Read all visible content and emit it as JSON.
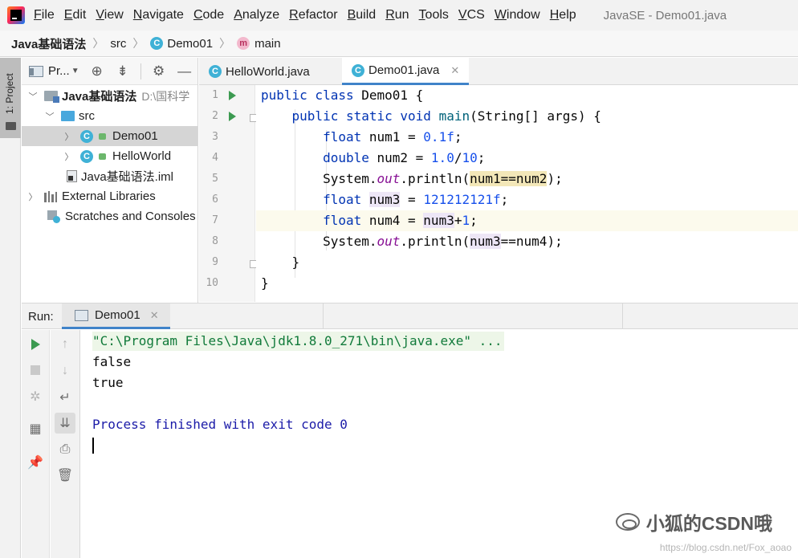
{
  "menubar": {
    "items": [
      "File",
      "Edit",
      "View",
      "Navigate",
      "Code",
      "Analyze",
      "Refactor",
      "Build",
      "Run",
      "Tools",
      "VCS",
      "Window",
      "Help"
    ],
    "window_title": "JavaSE - Demo01.java"
  },
  "breadcrumb": {
    "project": "Java基础语法",
    "folder": "src",
    "class": "Demo01",
    "method": "main",
    "class_icon": "C",
    "method_icon": "m"
  },
  "left_strip": {
    "project_tab": "1: Project"
  },
  "project_panel": {
    "header_label": "Pr...",
    "tree": {
      "root": "Java基础语法",
      "root_path": "D:\\国科学",
      "src": "src",
      "demo01": "Demo01",
      "helloworld": "HelloWorld",
      "iml": "Java基础语法.iml",
      "external_libraries": "External Libraries",
      "scratches": "Scratches and Consoles"
    }
  },
  "editor": {
    "tabs": [
      {
        "label": "HelloWorld.java",
        "icon": "C",
        "active": false
      },
      {
        "label": "Demo01.java",
        "icon": "C",
        "active": true
      }
    ],
    "line_numbers": [
      "1",
      "2",
      "3",
      "4",
      "5",
      "6",
      "7",
      "8",
      "9",
      "10"
    ],
    "code": {
      "l1_kw": "public class",
      "l1_rest": " Demo01 {",
      "l2_kw": "public static void",
      "l2_fn": "main",
      "l2_rest": "(String[] args) {",
      "l3_kw": "float",
      "l3_var": " num1 = ",
      "l3_num": "0.1f",
      "l3_end": ";",
      "l4_kw": "double",
      "l4_var": " num2 = ",
      "l4_num1": "1.0",
      "l4_op": "/",
      "l4_num2": "10",
      "l4_end": ";",
      "l5_pre": "System.",
      "l5_out": "out",
      "l5_mid": ".println(",
      "l5_arg": "num1==num2",
      "l5_end": ");",
      "l6_kw": "float",
      "l6_sp": " ",
      "l6_var": "num3",
      "l6_eq": " = ",
      "l6_num": "121212121f",
      "l6_end": ";",
      "l7_kw": "float",
      "l7_var": " num4 = ",
      "l7_ref": "num3",
      "l7_plus": "+",
      "l7_num": "1",
      "l7_end": ";",
      "l8_pre": "System.",
      "l8_out": "out",
      "l8_mid": ".println(",
      "l8_ref": "num3",
      "l8_rest": "==num4);",
      "l9": "}",
      "l10": "}"
    }
  },
  "run_panel": {
    "label": "Run:",
    "tab_label": "Demo01",
    "console": {
      "command": "\"C:\\Program Files\\Java\\jdk1.8.0_271\\bin\\java.exe\" ...",
      "out1": "false",
      "out2": "true",
      "exit": "Process finished with exit code 0"
    }
  },
  "watermark": {
    "text": "小狐的CSDN哦",
    "url": "https://blog.csdn.net/Fox_aoao"
  },
  "colors": {
    "keyword": "#0033b3",
    "number": "#1750eb",
    "static_field": "#871094",
    "run_green": "#3c9a51",
    "active_tab_accent": "#4083c9"
  },
  "icons": [
    "intellij-logo",
    "class-icon",
    "method-icon",
    "folder-icon",
    "settings-gear-icon",
    "locate-icon",
    "collapse-icon",
    "minimize-icon",
    "run-icon",
    "stop-icon",
    "rerun-icon",
    "pin-icon",
    "print-icon",
    "trash-icon",
    "soft-wrap-icon",
    "scroll-to-end-icon",
    "up-arrow-icon",
    "down-arrow-icon",
    "layout-icon",
    "close-icon"
  ]
}
